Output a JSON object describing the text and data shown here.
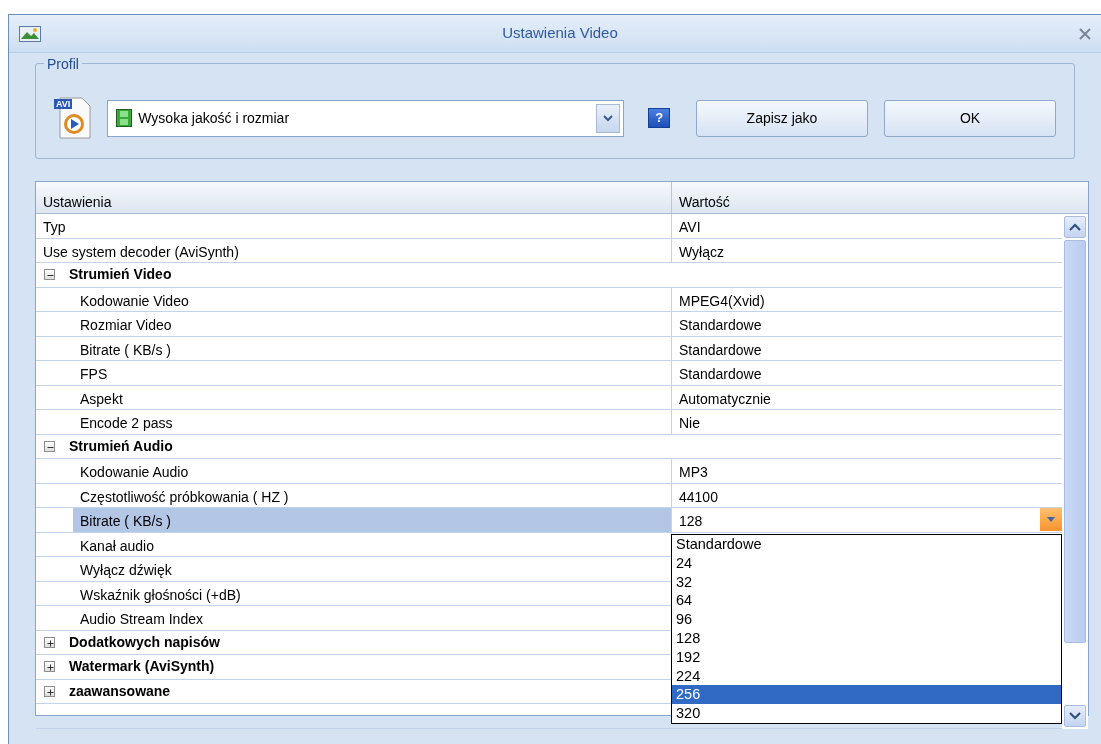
{
  "window": {
    "title": "Ustawienia Video"
  },
  "profile": {
    "legend": "Profil",
    "file_icon_label": "AVI",
    "selected_profile": "Wysoka jakość i rozmiar",
    "help": "?",
    "buttons": [
      "Zapisz jako",
      "OK"
    ]
  },
  "table": {
    "columns": [
      "Ustawienia",
      "Wartość"
    ],
    "rows": [
      {
        "kind": "property",
        "label": "Typ",
        "value": "AVI",
        "selected": false
      },
      {
        "kind": "property",
        "label": "Use system decoder (AviSynth)",
        "value": "Wyłącz",
        "selected": false
      },
      {
        "kind": "group",
        "label": "Strumień Video",
        "expanded": true,
        "children": [
          {
            "kind": "property",
            "label": "Kodowanie Video",
            "value": "MPEG4(Xvid)",
            "selected": false
          },
          {
            "kind": "property",
            "label": "Rozmiar Video",
            "value": "Standardowe",
            "selected": false
          },
          {
            "kind": "property",
            "label": "Bitrate ( KB/s )",
            "value": "Standardowe",
            "selected": false
          },
          {
            "kind": "property",
            "label": "FPS",
            "value": "Standardowe",
            "selected": false
          },
          {
            "kind": "property",
            "label": "Aspekt",
            "value": "Automatycznie",
            "selected": false
          },
          {
            "kind": "property",
            "label": "Encode 2 pass",
            "value": "Nie",
            "selected": false
          }
        ]
      },
      {
        "kind": "group",
        "label": "Strumień Audio",
        "expanded": true,
        "children": [
          {
            "kind": "property",
            "label": "Kodowanie Audio",
            "value": "MP3",
            "selected": false
          },
          {
            "kind": "property",
            "label": "Częstotliwość próbkowania ( HZ )",
            "value": "44100",
            "selected": false
          },
          {
            "kind": "property",
            "label": "Bitrate ( KB/s )",
            "value": "128",
            "selected": true
          },
          {
            "kind": "property",
            "label": "Kanał audio",
            "selected": false
          },
          {
            "kind": "property",
            "label": "Wyłącz dźwięk",
            "selected": false
          },
          {
            "kind": "property",
            "label": "Wskaźnik głośności (+dB)",
            "selected": false
          },
          {
            "kind": "property",
            "label": "Audio Stream Index",
            "selected": false
          }
        ]
      },
      {
        "kind": "group",
        "label": "Dodatkowych napisów",
        "expanded": false
      },
      {
        "kind": "group",
        "label": "Watermark (AviSynth)",
        "expanded": false
      },
      {
        "kind": "group",
        "label": "zaawansowane",
        "expanded": false
      }
    ]
  },
  "dropdown": {
    "options": [
      {
        "label": "Standardowe",
        "selected": false
      },
      {
        "label": "24",
        "selected": false
      },
      {
        "label": "32",
        "selected": false
      },
      {
        "label": "64",
        "selected": false
      },
      {
        "label": "96",
        "selected": false
      },
      {
        "label": "128",
        "selected": false
      },
      {
        "label": "192",
        "selected": false
      },
      {
        "label": "224",
        "selected": false
      },
      {
        "label": "256",
        "selected": true
      },
      {
        "label": "320",
        "selected": false
      }
    ]
  }
}
